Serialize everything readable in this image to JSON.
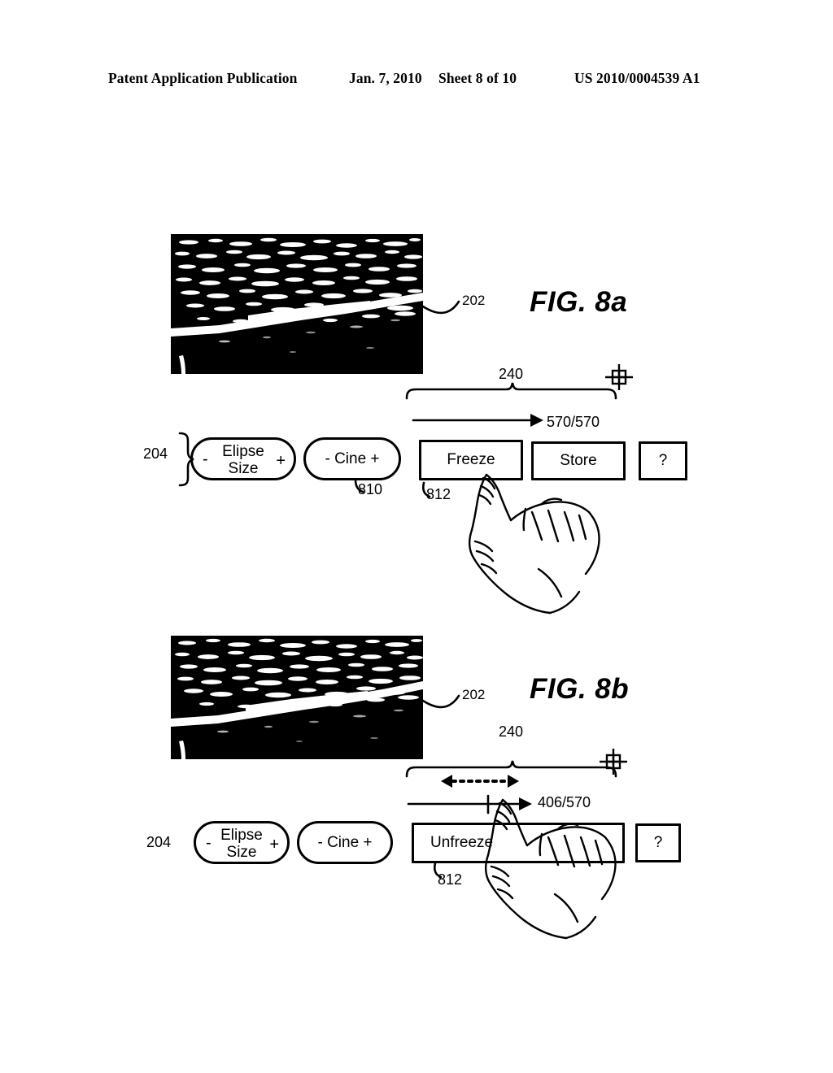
{
  "header": {
    "publication": "Patent Application Publication",
    "date": "Jan. 7, 2010",
    "sheet": "Sheet 8 of 10",
    "patent_number": "US 2010/0004539 A1"
  },
  "figures": [
    {
      "id": "fig-8a",
      "caption": "FIG. 8a",
      "image_ref": "202",
      "panel_ref": "240",
      "toolbar_ref": "204",
      "depth_label": "570/570",
      "cine_ref": "810",
      "freeze_ref": "812",
      "buttons": [
        {
          "name": "elipse-size",
          "shape": "pill",
          "minus": "-",
          "plus": "+",
          "line1": "Elipse",
          "line2": "Size"
        },
        {
          "name": "cine",
          "shape": "pill",
          "label": "- Cine +"
        },
        {
          "name": "freeze",
          "shape": "rect",
          "label": "Freeze"
        },
        {
          "name": "store",
          "shape": "rect",
          "label": "Store"
        },
        {
          "name": "help",
          "shape": "rect",
          "label": "?"
        }
      ],
      "arrow": {
        "type": "single-solid-right",
        "label": "570/570"
      }
    },
    {
      "id": "fig-8b",
      "caption": "FIG. 8b",
      "image_ref": "202",
      "panel_ref": "240",
      "toolbar_ref": "204",
      "depth_label": "406/570",
      "freeze_ref": "812",
      "buttons": [
        {
          "name": "elipse-size",
          "shape": "pill",
          "minus": "-",
          "plus": "+",
          "line1": "Elipse",
          "line2": "Size"
        },
        {
          "name": "cine",
          "shape": "pill",
          "label": "- Cine +"
        },
        {
          "name": "unfreeze",
          "shape": "rect",
          "label": "Unfreeze"
        },
        {
          "name": "help",
          "shape": "rect",
          "label": "?"
        }
      ],
      "arrow": {
        "type": "double-dotted",
        "label": "406/570"
      }
    }
  ],
  "icons": {
    "grid_crosshair": "grid-crosshair-icon",
    "hand_pointer": "hand-pointing-icon"
  },
  "colors": {
    "ink": "#000000",
    "paper": "#ffffff"
  }
}
